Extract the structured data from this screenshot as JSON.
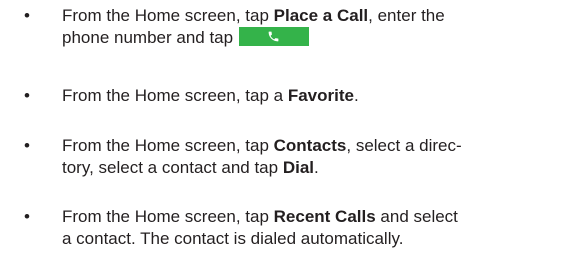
{
  "bullet_char": "•",
  "items": [
    {
      "line1_a": "From the Home screen, tap ",
      "line1_b": "Place a Call",
      "line1_c": ", enter the",
      "line2_a": "phone number and tap",
      "button_icon": "phone-handset-icon",
      "button_color": "#34b34a"
    },
    {
      "line1_a": "From the Home screen, tap a ",
      "line1_b": "Favorite",
      "line1_c": "."
    },
    {
      "line1_a": "From the Home screen, tap ",
      "line1_b": "Contacts",
      "line1_c": ", select a direc-",
      "line2_a": "tory, select a contact and tap ",
      "line2_b": "Dial",
      "line2_c": "."
    },
    {
      "line1_a": "From the Home screen, tap ",
      "line1_b": "Recent Calls",
      "line1_c": " and select",
      "line2_a": "a contact. The contact is dialed automatically."
    }
  ]
}
